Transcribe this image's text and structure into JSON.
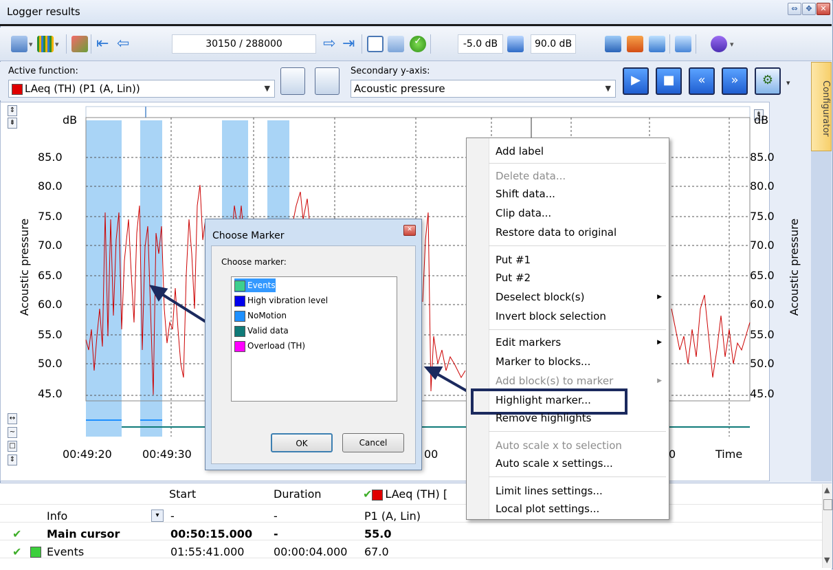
{
  "window": {
    "title": "Logger results"
  },
  "toolbar": {
    "position": "30150 / 288000",
    "min_db": "-5.0 dB",
    "max_db": "90.0 dB"
  },
  "function_bar": {
    "active_label": "Active function:",
    "active_value": "LAeq (TH) (P1 (A, Lin))",
    "secondary_label": "Secondary y-axis:",
    "secondary_value": "Acoustic pressure"
  },
  "config_tab": "Configurator",
  "chart_data": {
    "type": "line",
    "y_unit_left": "dB",
    "y_unit_right": "dB",
    "ylabel": "Acoustic pressure",
    "yticks": [
      "85.0",
      "80.0",
      "75.0",
      "70.0",
      "65.0",
      "60.0",
      "55.0",
      "50.0",
      "45.0"
    ],
    "xticks_visible": [
      "00:49:20",
      "00:49:30",
      "00",
      "0"
    ],
    "xlabel": "Time",
    "series_color": "#cc0000"
  },
  "context_menu": {
    "items": [
      {
        "label": "Add label",
        "enabled": true
      },
      {
        "label": "Delete data...",
        "enabled": false
      },
      {
        "label": "Shift data...",
        "enabled": true
      },
      {
        "label": "Clip data...",
        "enabled": true
      },
      {
        "label": "Restore data to original",
        "enabled": true
      },
      {
        "label": "Put #1",
        "enabled": true
      },
      {
        "label": "Put #2",
        "enabled": true
      },
      {
        "label": "Deselect block(s)",
        "enabled": true
      },
      {
        "label": "Invert block selection",
        "enabled": true
      },
      {
        "label": "Edit markers",
        "enabled": true
      },
      {
        "label": "Marker to blocks...",
        "enabled": true
      },
      {
        "label": "Add block(s) to marker",
        "enabled": false
      },
      {
        "label": "Highlight marker...",
        "enabled": true
      },
      {
        "label": "Remove highlights",
        "enabled": true
      },
      {
        "label": "Auto scale x to selection",
        "enabled": false
      },
      {
        "label": "Auto scale x settings...",
        "enabled": true
      },
      {
        "label": "Limit lines settings...",
        "enabled": true
      },
      {
        "label": "Local plot settings...",
        "enabled": true
      }
    ]
  },
  "dialog": {
    "title": "Choose Marker",
    "prompt": "Choose marker:",
    "markers": [
      {
        "label": "Events",
        "color": "#3dcf8e"
      },
      {
        "label": "High vibration level",
        "color": "#0000ee"
      },
      {
        "label": "NoMotion",
        "color": "#1e90ff"
      },
      {
        "label": "Valid data",
        "color": "#0f7a78"
      },
      {
        "label": "Overload (TH)",
        "color": "#ff00ff"
      }
    ],
    "ok": "OK",
    "cancel": "Cancel"
  },
  "grid": {
    "headers": [
      "Start",
      "Duration",
      "LAeq (TH) ["
    ],
    "rows": [
      {
        "name": "Info",
        "start": "-",
        "duration": "-",
        "value": "P1 (A, Lin)"
      },
      {
        "name": "Main cursor",
        "start": "00:50:15.000",
        "duration": "-",
        "value": "55.0"
      },
      {
        "name": "Events",
        "start": "01:55:41.000",
        "duration": "00:00:04.000",
        "value": "67.0"
      }
    ]
  }
}
